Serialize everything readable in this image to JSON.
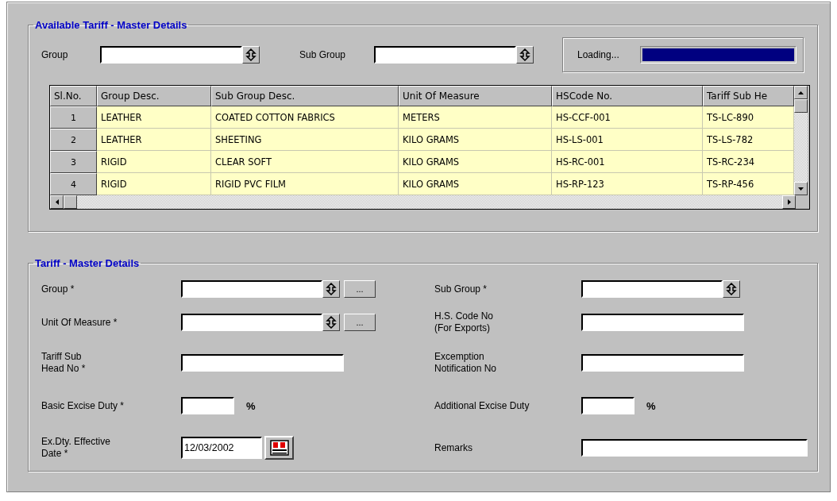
{
  "available": {
    "title": "Available Tariff - Master Details",
    "filters": [
      {
        "label": "Group"
      },
      {
        "label": "Sub Group"
      }
    ],
    "progress": {
      "label": "Loading...",
      "level": 1
    },
    "table": {
      "columns": [
        "Sl.No.",
        "Group Desc.",
        "Sub Group Desc.",
        "Unit Of Measure",
        "HSCode No.",
        "Tariff Sub He"
      ],
      "rows": [
        [
          "1",
          "LEATHER",
          "COATED COTTON FABRICS",
          "METERS",
          "HS-CCF-001",
          "TS-LC-890"
        ],
        [
          "2",
          "LEATHER",
          "SHEETING",
          "KILO GRAMS",
          "HS-LS-001",
          "TS-LS-782"
        ],
        [
          "3",
          "RIGID",
          "CLEAR SOFT",
          "KILO GRAMS",
          "HS-RC-001",
          "TS-RC-234"
        ],
        [
          "4",
          "RIGID",
          "RIGID PVC FILM",
          "KILO GRAMS",
          "HS-RP-123",
          "TS-RP-456"
        ]
      ]
    }
  },
  "form": {
    "title": "Tariff - Master Details",
    "left": [
      {
        "label": "Group *",
        "kind": "combo",
        "browse": "..."
      },
      {
        "label": "Unit Of Measure *",
        "kind": "combo",
        "browse": "..."
      },
      {
        "label": "Tariff Sub\nHead No *",
        "kind": "text"
      },
      {
        "label": "Basic Excise Duty *",
        "kind": "percent",
        "unit": "%"
      },
      {
        "label": "Ex.Dty. Effective\nDate *",
        "kind": "date",
        "value": "12/03/2002"
      }
    ],
    "right": [
      {
        "label": "Sub Group *",
        "kind": "combo"
      },
      {
        "label": "H.S. Code No\n(For Exports)",
        "kind": "text"
      },
      {
        "label": "Excemption\nNotification No",
        "kind": "text"
      },
      {
        "label": "Additional Excise Duty",
        "kind": "percent",
        "unit": "%"
      },
      {
        "label": "Remarks",
        "kind": "wide"
      }
    ]
  }
}
